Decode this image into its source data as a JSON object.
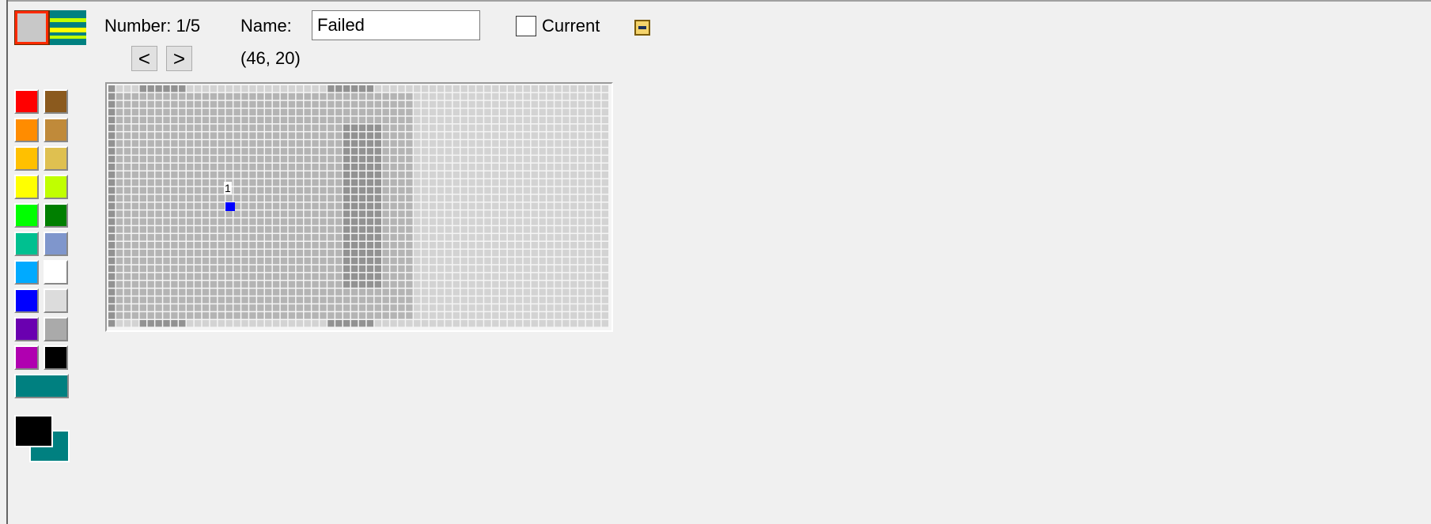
{
  "toolbar": {
    "number_label": "Number: 1/5",
    "name_label": "Name:",
    "name_value": "Failed",
    "current_label": "Current",
    "coordinates": "(46, 20)",
    "prev_glyph": "<",
    "next_glyph": ">",
    "current_checked": false
  },
  "palette": {
    "colors": [
      "#ff0000",
      "#8b5a1e",
      "#ff8c00",
      "#c08a3a",
      "#ffc000",
      "#dfc050",
      "#ffff00",
      "#c0ff00",
      "#00ff00",
      "#007f00",
      "#00c090",
      "#7f96cc",
      "#00aaff",
      "#ffffff",
      "#0000ff",
      "#dcdcdc",
      "#6a00b0",
      "#aaaaaa",
      "#b000b0",
      "#000000"
    ],
    "wide_color": "#008080",
    "primary_color": "#000000",
    "secondary_color": "#008080"
  },
  "grid": {
    "cell_colors": {
      "light": "#d3d3d3",
      "medium": "#b4b4b4",
      "dark": "#929292"
    },
    "marker_label": "1",
    "marker_color": "#0000ff"
  },
  "icons": [
    "preview-icon",
    "chevron-left-icon",
    "chevron-right-icon",
    "collapse-icon"
  ]
}
